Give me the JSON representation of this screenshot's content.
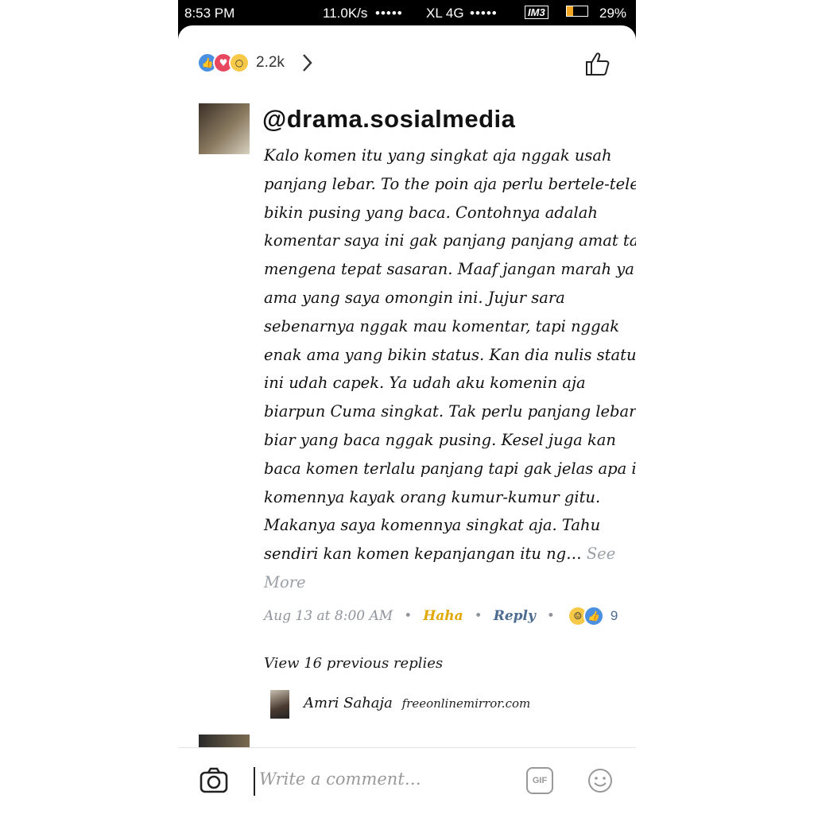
{
  "status_bar": {
    "time": "8:53 PM",
    "speed": "11.0K/s",
    "signal1": "•••••",
    "network": "XL 4G",
    "signal2": "•••••",
    "carrier": "IM3",
    "battery_percent": "29%",
    "battery_level": 0.29
  },
  "reactions": {
    "icons": [
      "like-icon",
      "love-icon",
      "wow-icon"
    ],
    "count": "2.2k"
  },
  "comment": {
    "author_handle": "@drama.sosialmedia",
    "lines": [
      "Kalo komen itu yang singkat aja nggak usah",
      "panjang lebar. To the poin aja perlu bertele-tele",
      "bikin pusing yang baca. Contohnya adalah",
      "komentar saya ini gak panjang panjang amat tapi",
      "mengena tepat sasaran. Maaf jangan marah ya",
      "ama yang saya omongin ini. Jujur sara",
      "sebenarnya nggak mau komentar, tapi nggak",
      "enak ama yang bikin status. Kan dia nulis status",
      "ini udah capek. Ya udah aku komenin aja",
      "biarpun Cuma singkat. Tak perlu panjang lebar",
      "biar yang baca nggak pusing. Kesel juga kan",
      "baca komen terlalu panjang tapi gak jelas apa isi",
      "komennya kayak orang kumur-kumur gitu.",
      "Makanya saya komennya singkat aja. Tahu"
    ],
    "last_line": "sendiri kan komen kepanjangan itu ng…",
    "see_more_1": "See",
    "see_more_2": "More",
    "timestamp": "Aug 13 at 8:00 AM",
    "reaction_label": "Haha",
    "reply_label": "Reply",
    "reaction_count": "9"
  },
  "replies": {
    "view_previous": "View 16 previous replies",
    "reply_author": "Amri Sahaja",
    "reply_source": "freeonlinemirror.com"
  },
  "composer": {
    "placeholder": "Write a comment…",
    "gif_label": "GIF"
  },
  "colors": {
    "like_blue": "#4a90e2",
    "love_red": "#e8485f",
    "haha_yellow": "#e0a800",
    "link_blue": "#4b6b8f"
  }
}
